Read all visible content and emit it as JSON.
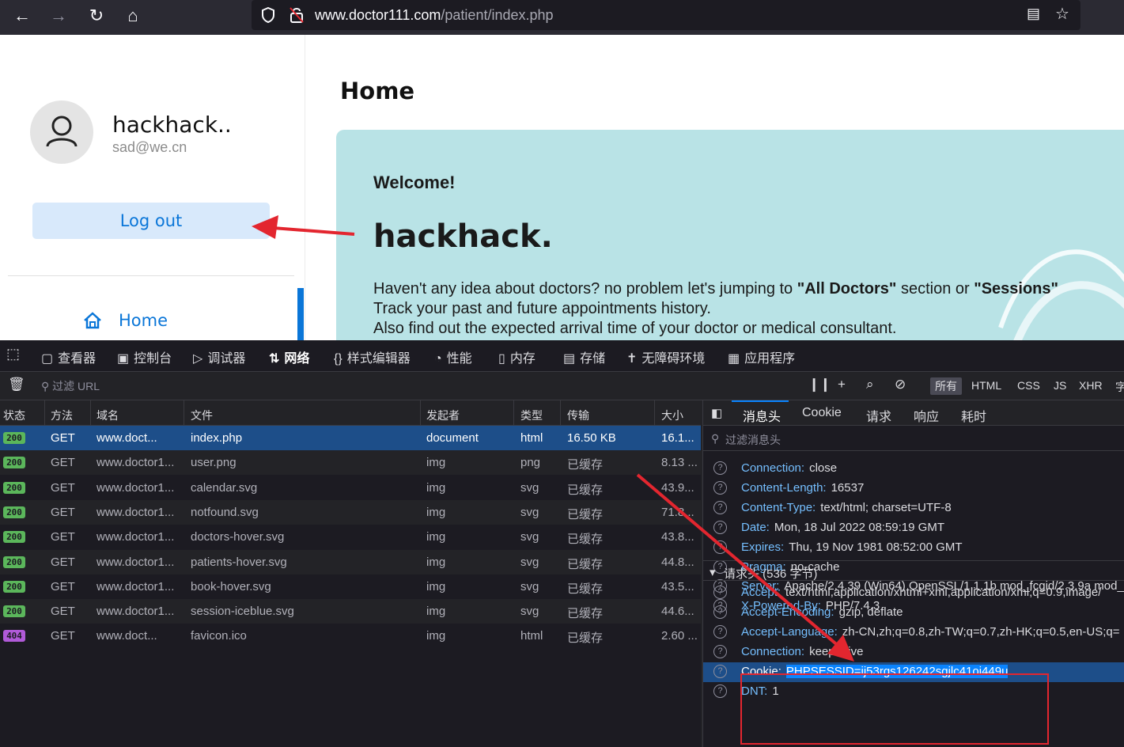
{
  "browser": {
    "url_host": "www.doctor111.com",
    "url_path": "/patient/index.php",
    "back_icon": "arrow-left-icon",
    "forward_icon": "arrow-right-icon",
    "reload_icon": "reload-icon",
    "home_icon": "home-icon"
  },
  "sidebar": {
    "user_name": "hackhack..",
    "user_email": "sad@we.cn",
    "logout_label": "Log out",
    "nav_home_label": "Home"
  },
  "main": {
    "page_title": "Home",
    "welcome": "Welcome!",
    "hero_name": "hackhack.",
    "line1_pre": "Haven't any idea about doctors? no problem let's jumping to ",
    "line1_b1": "\"All Doctors\"",
    "line1_mid": " section or ",
    "line1_b2": "\"Sessions\"",
    "line2": "Track your past and future appointments history.",
    "line3": "Also find out the expected arrival time of your doctor or medical consultant."
  },
  "devtools": {
    "tabs": [
      "查看器",
      "控制台",
      "调试器",
      "网络",
      "样式编辑器",
      "性能",
      "内存",
      "存储",
      "无障碍环境",
      "应用程序"
    ],
    "filter_placeholder": "过滤 URL",
    "type_filters": [
      "所有",
      "HTML",
      "CSS",
      "JS",
      "XHR",
      "字"
    ],
    "columns": [
      "状态",
      "方法",
      "域名",
      "文件",
      "发起者",
      "类型",
      "传输",
      "大小"
    ],
    "requests": [
      {
        "status": "200",
        "method": "GET",
        "domain": "www.doct...",
        "file": "index.php",
        "initiator": "document",
        "type": "html",
        "transfer": "16.50 KB",
        "size": "16.1..."
      },
      {
        "status": "200",
        "method": "GET",
        "domain": "www.doctor1...",
        "file": "user.png",
        "initiator": "img",
        "type": "png",
        "transfer": "已缓存",
        "size": "8.13 ..."
      },
      {
        "status": "200",
        "method": "GET",
        "domain": "www.doctor1...",
        "file": "calendar.svg",
        "initiator": "img",
        "type": "svg",
        "transfer": "已缓存",
        "size": "43.9..."
      },
      {
        "status": "200",
        "method": "GET",
        "domain": "www.doctor1...",
        "file": "notfound.svg",
        "initiator": "img",
        "type": "svg",
        "transfer": "已缓存",
        "size": "71.8..."
      },
      {
        "status": "200",
        "method": "GET",
        "domain": "www.doctor1...",
        "file": "doctors-hover.svg",
        "initiator": "img",
        "type": "svg",
        "transfer": "已缓存",
        "size": "43.8..."
      },
      {
        "status": "200",
        "method": "GET",
        "domain": "www.doctor1...",
        "file": "patients-hover.svg",
        "initiator": "img",
        "type": "svg",
        "transfer": "已缓存",
        "size": "44.8..."
      },
      {
        "status": "200",
        "method": "GET",
        "domain": "www.doctor1...",
        "file": "book-hover.svg",
        "initiator": "img",
        "type": "svg",
        "transfer": "已缓存",
        "size": "43.5..."
      },
      {
        "status": "200",
        "method": "GET",
        "domain": "www.doctor1...",
        "file": "session-iceblue.svg",
        "initiator": "img",
        "type": "svg",
        "transfer": "已缓存",
        "size": "44.6..."
      },
      {
        "status": "404",
        "method": "GET",
        "domain": "www.doct...",
        "file": "favicon.ico",
        "initiator": "img",
        "type": "html",
        "transfer": "已缓存",
        "size": "2.60 ..."
      }
    ],
    "detail_tabs": [
      "消息头",
      "Cookie",
      "请求",
      "响应",
      "耗时"
    ],
    "detail_filter": "过滤消息头",
    "response_headers": [
      {
        "key": "Connection:",
        "value": "close"
      },
      {
        "key": "Content-Length:",
        "value": "16537"
      },
      {
        "key": "Content-Type:",
        "value": "text/html; charset=UTF-8"
      },
      {
        "key": "Date:",
        "value": "Mon, 18 Jul 2022 08:59:19 GMT"
      },
      {
        "key": "Expires:",
        "value": "Thu, 19 Nov 1981 08:52:00 GMT"
      },
      {
        "key": "Pragma:",
        "value": "no-cache"
      },
      {
        "key": "Server:",
        "value": "Apache/2.4.39 (Win64) OpenSSL/1.1.1b mod_fcgid/2.3.9a mod_"
      },
      {
        "key": "X-Powered-By:",
        "value": "PHP/7.4.3"
      }
    ],
    "request_section": "请求头 (536 字节)",
    "request_headers": [
      {
        "key": "Accept:",
        "value": "text/html,application/xhtml+xml,application/xml;q=0.9,image/"
      },
      {
        "key": "Accept-Encoding:",
        "value": "gzip, deflate"
      },
      {
        "key": "Accept-Language:",
        "value": "zh-CN,zh;q=0.8,zh-TW;q=0.7,zh-HK;q=0.5,en-US;q="
      },
      {
        "key": "Connection:",
        "value": "keep-alive"
      },
      {
        "key": "Cookie:",
        "value": "PHPSESSID=ij53rgs126242sgjlc41oi449u"
      },
      {
        "key": "DNT:",
        "value": "1"
      }
    ]
  },
  "colors": {
    "accent": "#0a76d8",
    "annotation": "#e3262f",
    "ok_badge": "#5bb65b",
    "err_badge": "#b05ad8"
  }
}
